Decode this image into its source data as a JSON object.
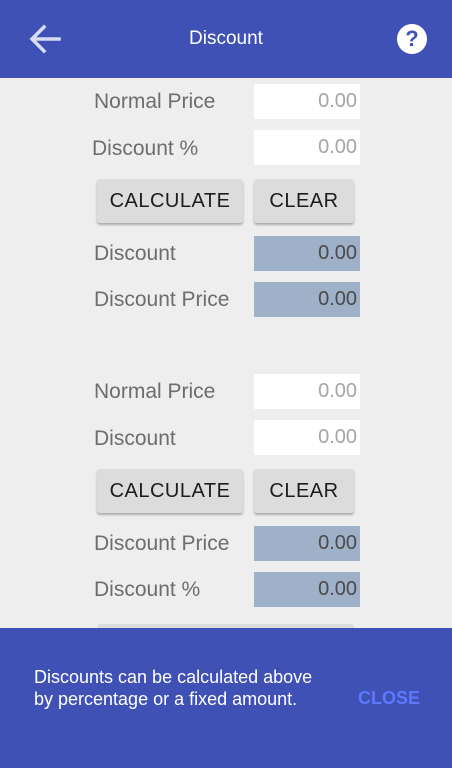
{
  "appbar": {
    "title": "Discount",
    "back_icon": "arrow-left-icon",
    "help_icon": "question-circle-icon",
    "help_glyph": "?"
  },
  "percent_section": {
    "normal_price_label": "Normal Price",
    "normal_price_value": "0.00",
    "discount_percent_label": "Discount %",
    "discount_percent_value": "0.00",
    "calculate_label": "CALCULATE",
    "clear_label": "CLEAR",
    "discount_label": "Discount",
    "discount_result": "0.00",
    "discount_price_label": "Discount Price",
    "discount_price_result": "0.00"
  },
  "fixed_section": {
    "normal_price_label": "Normal Price",
    "normal_price_value": "0.00",
    "discount_label": "Discount",
    "discount_value": "0.00",
    "calculate_label": "CALCULATE",
    "clear_label": "CLEAR",
    "discount_price_label": "Discount Price",
    "discount_price_result": "0.00",
    "discount_percent_label": "Discount %",
    "discount_percent_result": "0.00"
  },
  "snackbar": {
    "message": "Discounts can be calculated above by percentage or a fixed amount.",
    "action": "CLOSE"
  },
  "colors": {
    "primary": "#3f51b5",
    "result_bg": "#9fb0c9",
    "accent": "#5d78ff"
  }
}
